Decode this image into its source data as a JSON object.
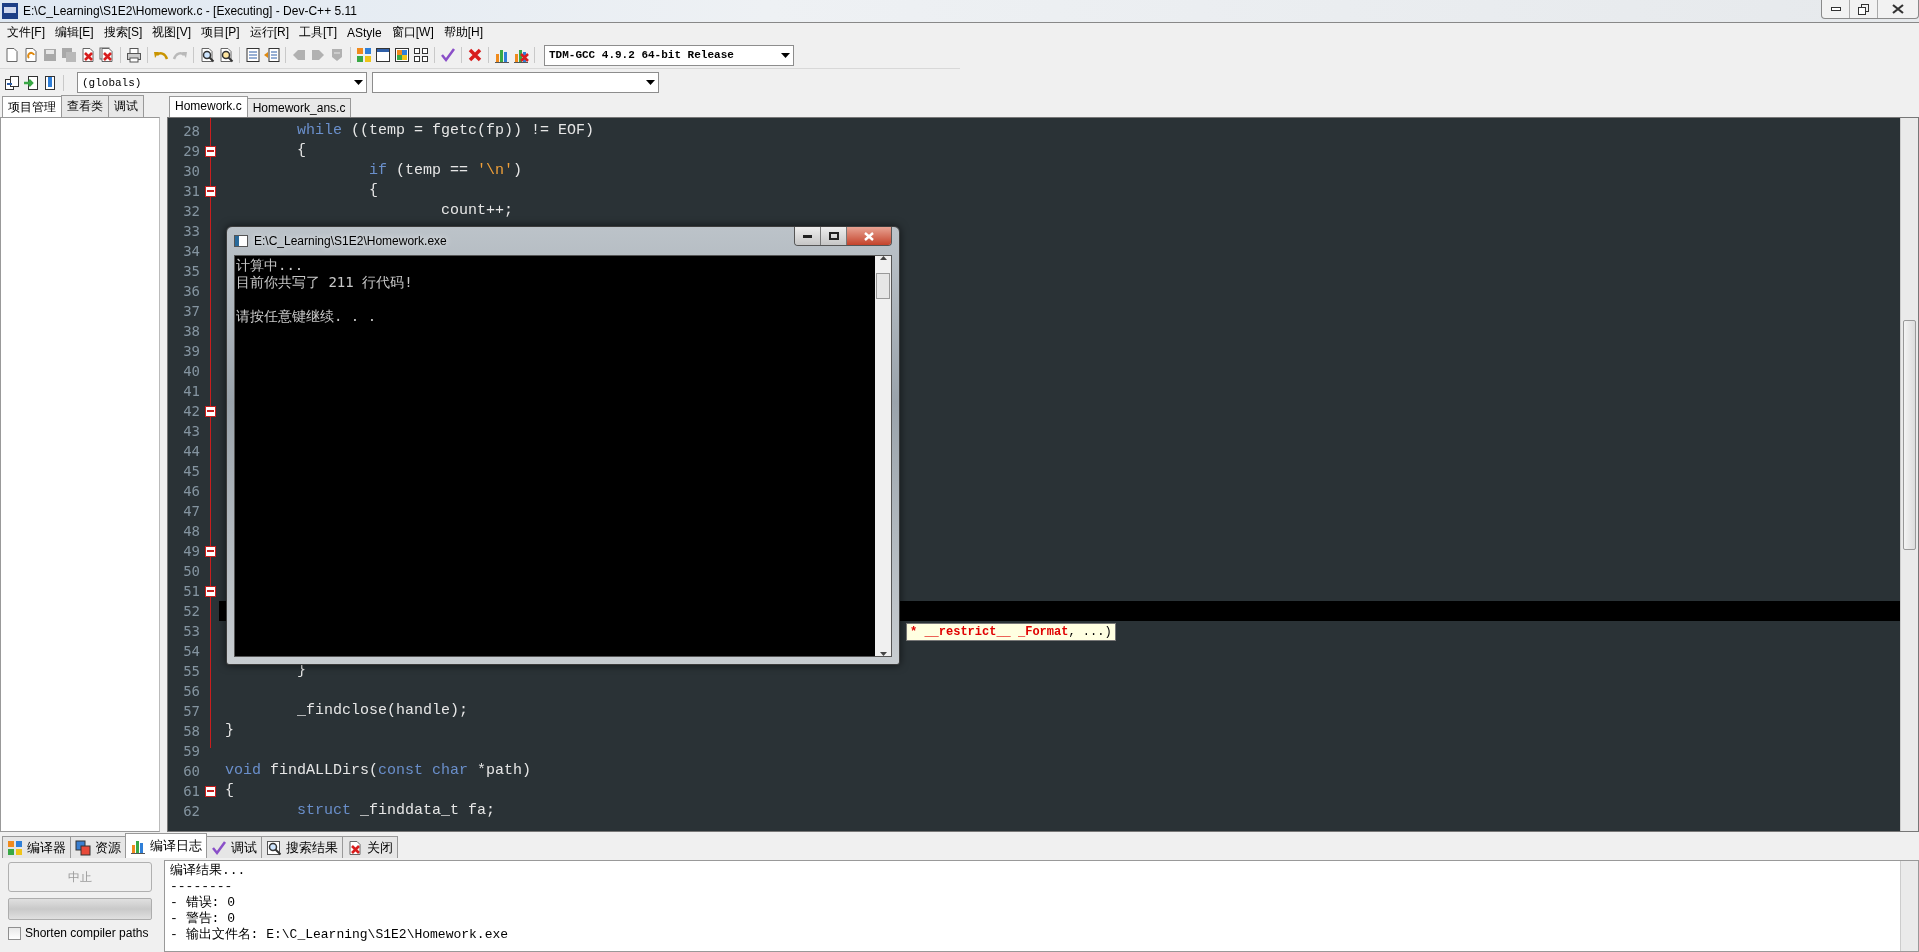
{
  "window": {
    "title": "E:\\C_Learning\\S1E2\\Homework.c - [Executing] - Dev-C++ 5.11"
  },
  "menu": [
    "文件[F]",
    "编辑[E]",
    "搜索[S]",
    "视图[V]",
    "项目[P]",
    "运行[R]",
    "工具[T]",
    "AStyle",
    "窗口[W]",
    "帮助[H]"
  ],
  "toolbar": {
    "groups": [
      {
        "items": [
          {
            "kind": "new",
            "disabled": false
          },
          {
            "kind": "open",
            "disabled": false
          },
          {
            "kind": "save",
            "disabled": true
          },
          {
            "kind": "save-all",
            "disabled": true
          },
          {
            "kind": "close",
            "disabled": false
          },
          {
            "kind": "close-all",
            "disabled": false
          }
        ]
      },
      {
        "items": [
          {
            "kind": "print",
            "disabled": false
          }
        ]
      },
      {
        "items": [
          {
            "kind": "undo",
            "disabled": false
          },
          {
            "kind": "redo",
            "disabled": true
          }
        ]
      },
      {
        "items": [
          {
            "kind": "find",
            "disabled": false
          },
          {
            "kind": "replace",
            "disabled": false
          }
        ]
      },
      {
        "items": [
          {
            "kind": "indent",
            "disabled": false
          },
          {
            "kind": "unindent",
            "disabled": false
          }
        ]
      },
      {
        "items": [
          {
            "kind": "prev",
            "disabled": true
          },
          {
            "kind": "next",
            "disabled": true
          },
          {
            "kind": "goto",
            "disabled": true
          }
        ]
      },
      {
        "items": [
          {
            "kind": "compile",
            "disabled": false
          },
          {
            "kind": "run",
            "disabled": false
          },
          {
            "kind": "compile-run",
            "disabled": false
          },
          {
            "kind": "rebuild",
            "disabled": false
          }
        ]
      },
      {
        "items": [
          {
            "kind": "check",
            "disabled": false
          }
        ]
      },
      {
        "items": [
          {
            "kind": "stop",
            "disabled": false
          }
        ]
      },
      {
        "items": [
          {
            "kind": "chart",
            "disabled": false
          },
          {
            "kind": "chart-delete",
            "disabled": false
          }
        ]
      }
    ],
    "compiler": "TDM-GCC 4.9.2 64-bit Release"
  },
  "toolbar2": {
    "items": [
      {
        "kind": "class-add"
      },
      {
        "kind": "class-insert"
      },
      {
        "kind": "bookmark"
      }
    ],
    "scope": "(globals)"
  },
  "side_panel": {
    "tabs": [
      {
        "label": "项目管理",
        "selected": true
      },
      {
        "label": "查看类",
        "selected": false
      },
      {
        "label": "调试",
        "selected": false
      }
    ]
  },
  "editor": {
    "tabs": [
      {
        "label": "Homework.c",
        "selected": true
      },
      {
        "label": "Homework_ans.c",
        "selected": false
      }
    ],
    "lines": [
      {
        "number": "28",
        "fold_marker": false,
        "active": false,
        "tokens": [
          {
            "text": "\twhile",
            "kind": "keyword"
          },
          {
            "text": " ((temp = fgetc(fp)) != EOF)",
            "kind": "plain"
          }
        ]
      },
      {
        "number": "29",
        "fold_marker": true,
        "active": false,
        "tokens": [
          {
            "text": "\t{",
            "kind": "plain"
          }
        ]
      },
      {
        "number": "30",
        "fold_marker": false,
        "active": false,
        "tokens": [
          {
            "text": "\t\tif",
            "kind": "keyword"
          },
          {
            "text": " (temp == ",
            "kind": "plain"
          },
          {
            "text": "'\\n'",
            "kind": "string"
          },
          {
            "text": ")",
            "kind": "plain"
          }
        ]
      },
      {
        "number": "31",
        "fold_marker": true,
        "active": false,
        "tokens": [
          {
            "text": "\t\t{",
            "kind": "plain"
          }
        ]
      },
      {
        "number": "32",
        "fold_marker": false,
        "active": false,
        "tokens": [
          {
            "text": "\t\t\tcount++;",
            "kind": "plain"
          }
        ]
      },
      {
        "number": "33",
        "fold_marker": false,
        "active": false
      },
      {
        "number": "34",
        "fold_marker": false,
        "active": false
      },
      {
        "number": "35",
        "fold_marker": false,
        "active": false
      },
      {
        "number": "36",
        "fold_marker": false,
        "active": false
      },
      {
        "number": "37",
        "fold_marker": false,
        "active": false
      },
      {
        "number": "38",
        "fold_marker": false,
        "active": false
      },
      {
        "number": "39",
        "fold_marker": false,
        "active": false
      },
      {
        "number": "40",
        "fold_marker": false,
        "active": false
      },
      {
        "number": "41",
        "fold_marker": false,
        "active": false
      },
      {
        "number": "42",
        "fold_marker": true,
        "active": false
      },
      {
        "number": "43",
        "fold_marker": false,
        "active": false
      },
      {
        "number": "44",
        "fold_marker": false,
        "active": false
      },
      {
        "number": "45",
        "fold_marker": false,
        "active": false
      },
      {
        "number": "46",
        "fold_marker": false,
        "active": false
      },
      {
        "number": "47",
        "fold_marker": false,
        "active": false
      },
      {
        "number": "48",
        "fold_marker": false,
        "active": false
      },
      {
        "number": "49",
        "fold_marker": true,
        "active": false
      },
      {
        "number": "50",
        "fold_marker": false,
        "active": false
      },
      {
        "number": "51",
        "fold_marker": true,
        "active": false
      },
      {
        "number": "52",
        "fold_marker": false,
        "active": true
      },
      {
        "number": "53",
        "fold_marker": false,
        "active": false
      },
      {
        "number": "54",
        "fold_marker": false,
        "active": false
      },
      {
        "number": "55",
        "fold_marker": false,
        "active": false,
        "tokens": [
          {
            "text": "\t}",
            "kind": "plain"
          }
        ]
      },
      {
        "number": "56",
        "fold_marker": false,
        "active": false
      },
      {
        "number": "57",
        "fold_marker": false,
        "active": false,
        "tokens": [
          {
            "text": "\t_findclose(handle);",
            "kind": "plain"
          }
        ]
      },
      {
        "number": "58",
        "fold_marker": false,
        "active": false,
        "tokens": [
          {
            "text": "}",
            "kind": "plain"
          }
        ]
      },
      {
        "number": "59",
        "fold_marker": false,
        "active": false
      },
      {
        "number": "60",
        "fold_marker": false,
        "active": false,
        "tokens": [
          {
            "text": "void",
            "kind": "keyword"
          },
          {
            "text": " findALLDirs(",
            "kind": "plain"
          },
          {
            "text": "const",
            "kind": "keyword"
          },
          {
            "text": " char",
            "kind": "keyword"
          },
          {
            "text": " *path)",
            "kind": "plain"
          }
        ]
      },
      {
        "number": "61",
        "fold_marker": true,
        "active": false,
        "tokens": [
          {
            "text": "{",
            "kind": "plain"
          }
        ]
      },
      {
        "number": "62",
        "fold_marker": false,
        "active": false,
        "tokens": [
          {
            "text": "\tstruct",
            "kind": "keyword"
          },
          {
            "text": " _finddata_t fa;",
            "kind": "plain"
          }
        ]
      }
    ],
    "calltip": [
      {
        "text": "* __restrict__ _Format",
        "kind": "param"
      },
      {
        "text": ", ...)",
        "kind": "plain"
      }
    ]
  },
  "console": {
    "title": "E:\\C_Learning\\S1E2\\Homework.exe",
    "paragraphs": [
      [
        "计算中...",
        "目前你共写了 211 行代码!"
      ],
      [
        "请按任意键继续. . ."
      ]
    ]
  },
  "bottom": {
    "tabs": [
      {
        "label": "编译器",
        "kind": "compiler",
        "selected": false
      },
      {
        "label": "资源",
        "kind": "resources",
        "selected": false
      },
      {
        "label": "编译日志",
        "kind": "log",
        "selected": true
      },
      {
        "label": "调试",
        "kind": "debug",
        "selected": false
      },
      {
        "label": "搜索结果",
        "kind": "search",
        "selected": false
      },
      {
        "label": "关闭",
        "kind": "close",
        "selected": false
      }
    ],
    "stop_button": {
      "label": "中止",
      "disabled": true
    },
    "progress": {
      "level": 0
    },
    "option": {
      "label": "Shorten compiler paths",
      "checked": false
    },
    "log": [
      "编译结果...",
      "--------",
      "- 错误: 0",
      "- 警告: 0",
      "- 输出文件名: E:\\C_Learning\\S1E2\\Homework.exe"
    ]
  }
}
